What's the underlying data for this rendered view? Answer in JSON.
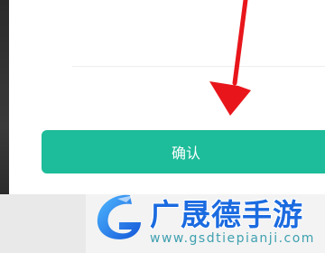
{
  "dialog": {
    "confirm_label": "确认"
  },
  "watermark": {
    "title": "广晟德手游",
    "url": "www.gsdtiepianji.com"
  },
  "colors": {
    "button": "#1dbc9a",
    "arrow": "#e8161b",
    "watermark_blue": "#1b6be0"
  }
}
